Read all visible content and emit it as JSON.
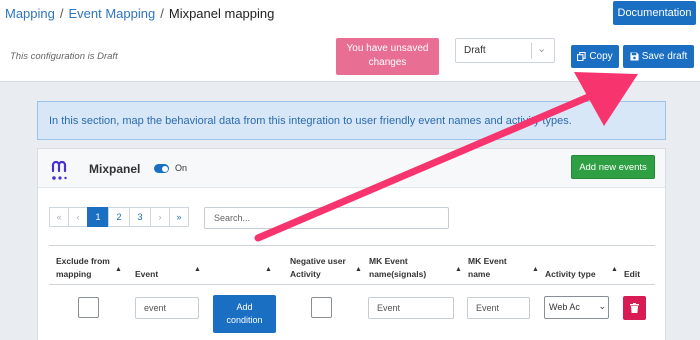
{
  "breadcrumb": {
    "items": [
      "Mapping",
      "Event Mapping"
    ],
    "separator": "/",
    "current": "Mixpanel mapping"
  },
  "header": {
    "documentation_label": "Documentation",
    "draft_note": "This configuration is Draft",
    "unsaved_line1": "You have unsaved",
    "unsaved_line2": "changes",
    "status_select_value": "Draft",
    "copy_label": "Copy",
    "save_draft_label": "Save draft"
  },
  "info_banner": {
    "text": "In this section, map the behavioral data from this integration to user friendly event names and activity types."
  },
  "card": {
    "title": "Mixpanel",
    "toggle_label": "On",
    "toggle_on": true,
    "add_events_label": "Add new events"
  },
  "pagination": {
    "first": "«",
    "prev": "‹",
    "pages": [
      "1",
      "2",
      "3"
    ],
    "active_page": "1",
    "next": "›",
    "last": "»"
  },
  "search": {
    "placeholder": "Search..."
  },
  "table": {
    "headers": {
      "exclude_line1": "Exclude from",
      "exclude_line2": "mapping",
      "event": "Event",
      "negative_line1": "Negative user",
      "negative_line2": "Activity",
      "mk_signals_line1": "MK Event",
      "mk_signals_line2": "name(signals)",
      "mk_name_line1": "MK Event",
      "mk_name_line2": "name",
      "activity_type": "Activity type",
      "edit": "Edit"
    },
    "rows": [
      {
        "event": "event",
        "add_condition_line1": "Add",
        "add_condition_line2": "condition",
        "mk_signals": "Event",
        "mk_name": "Event",
        "activity_type": "Web Ac"
      }
    ]
  },
  "colors": {
    "primary": "#1a6fc2",
    "success": "#2ea043",
    "unsaved": "#e96e93",
    "danger": "#d81b52",
    "annotation_arrow": "#f7346e",
    "info_bg": "#d7e7f7"
  }
}
